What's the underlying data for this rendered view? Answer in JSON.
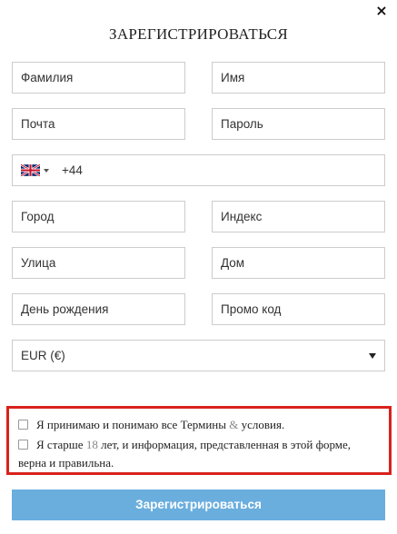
{
  "close_icon": "×",
  "title": "ЗАРЕГИСТРИРОВАТЬСЯ",
  "fields": {
    "last_name": "Фамилия",
    "first_name": "Имя",
    "email": "Почта",
    "password": "Пароль",
    "phone_code": "+44",
    "city": "Город",
    "postcode": "Индекс",
    "street": "Улица",
    "house": "Дом",
    "birthday": "День рождения",
    "promo": "Промо код"
  },
  "phone_flag": "uk-flag-icon",
  "currency": "EUR  (€)",
  "terms": {
    "accept_text_1": "Я принимаю и понимаю все Термины",
    "accept_amp": "&",
    "accept_text_2": "условия.",
    "age_text_1": "Я старше",
    "age_number": "18",
    "age_text_2": "лет, и информация, представленная в этой форме,",
    "age_text_3": "верна и правильна."
  },
  "submit_label": "Зарегистрироваться",
  "colors": {
    "accent": "#6aaede",
    "highlight_border": "#d9221c"
  }
}
